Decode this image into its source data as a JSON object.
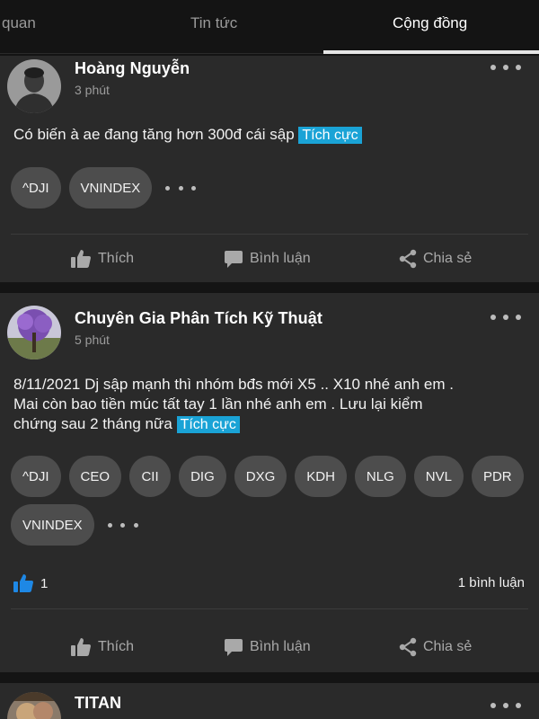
{
  "tabs": [
    {
      "label": "quan"
    },
    {
      "label": "Tin tức"
    },
    {
      "label": "Cộng đồng"
    }
  ],
  "active_tab": "Cộng đồng",
  "actions": {
    "like": "Thích",
    "comment": "Bình luận",
    "share": "Chia sẻ"
  },
  "posts": [
    {
      "author": "Hoàng Nguyễn",
      "time": "3 phút",
      "content_lines": [
        "Có biến à ae đang tăng hơn 300đ cái sập"
      ],
      "sentiment": "Tích cực",
      "tickers": [
        "^DJI",
        "VNINDEX"
      ]
    },
    {
      "author": "Chuyên Gia Phân Tích Kỹ Thuật",
      "time": "5 phút",
      "content_lines": [
        "8/11/2021 Dj sập mạnh thì nhóm bđs mới X5 .. X10 nhé anh em .",
        "Mai còn bao tiền múc tất tay 1 lần nhé anh em . Lưu lại kiểm",
        "chứng  sau 2 tháng nữa"
      ],
      "sentiment": "Tích cực",
      "tickers": [
        "^DJI",
        "CEO",
        "CII",
        "DIG",
        "DXG",
        "KDH",
        "NLG",
        "NVL",
        "PDR",
        "VNINDEX"
      ],
      "like_count": "1",
      "comment_count": "1 bình luận"
    },
    {
      "author": "TITAN"
    }
  ],
  "icons": {
    "like": "thumbs-up-icon",
    "comment": "comment-bubble-icon",
    "share": "share-icon",
    "more": "more-dots-icon"
  },
  "colors": {
    "background": "#141414",
    "card": "#2a2a2a",
    "chip": "#4d4d4d",
    "sentiment_badge": "#1aa3d6",
    "like_active": "#1e88e5"
  }
}
